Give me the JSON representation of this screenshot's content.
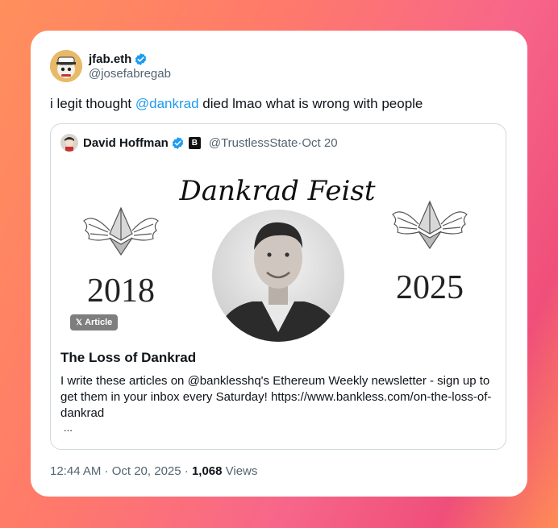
{
  "tweet": {
    "author_name": "jfab.eth",
    "author_handle": "@josefabregab",
    "text_before": "i legit thought ",
    "mention": "@dankrad",
    "text_after": " died lmao what is wrong with people",
    "timestamp": "12:44 AM · Oct 20, 2025 · ",
    "views_count": "1,068",
    "views_label": " Views"
  },
  "quote": {
    "author_name": "David Hoffman",
    "badge_letter": "B",
    "author_handle": "@TrustlessState",
    "separator": " · ",
    "date": "Oct 20",
    "image": {
      "script_title": "Dankrad Feist",
      "year_left": "2018",
      "year_right": "2025"
    },
    "article_pill": "Article",
    "article_title": "The Loss of Dankrad",
    "article_description": "I write these articles on @banklesshq's Ethereum Weekly newsletter - sign up to get them in your inbox every Saturday! https://www.bankless.com/on-the-loss-of-dankrad",
    "ellipsis": "..."
  },
  "colors": {
    "accent": "#1d9bf0",
    "text": "#0f1419",
    "muted": "#536471"
  }
}
